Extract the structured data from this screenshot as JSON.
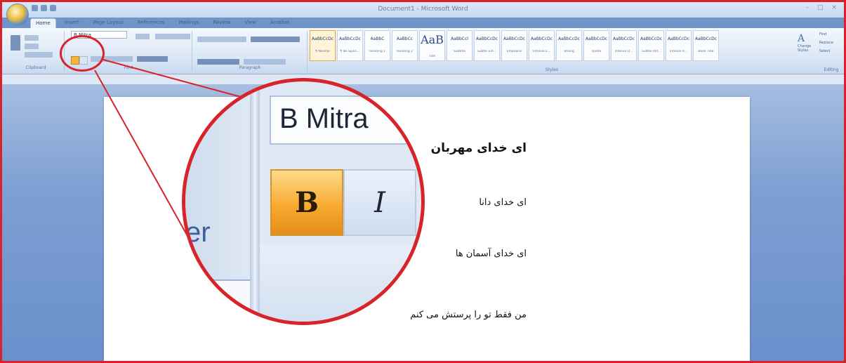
{
  "window": {
    "title": "Document1 - Microsoft Word"
  },
  "tabs": [
    "Home",
    "Insert",
    "Page Layout",
    "References",
    "Mailings",
    "Review",
    "View",
    "Acrobat"
  ],
  "ribbon": {
    "font_name": "B Mitra",
    "groups": [
      "Clipboard",
      "Font",
      "Paragraph",
      "Styles",
      "Editing"
    ],
    "styles": [
      {
        "sample": "AaBbCcDc",
        "name": "¶ Normal"
      },
      {
        "sample": "AaBbCcDc",
        "name": "¶ No Spaci..."
      },
      {
        "sample": "AaBbC",
        "name": "Heading 1"
      },
      {
        "sample": "AaBbCc",
        "name": "Heading 2"
      },
      {
        "sample": "AaB",
        "name": "Title"
      },
      {
        "sample": "AaBbCcl",
        "name": "Subtitle"
      },
      {
        "sample": "AaBbCcDc",
        "name": "Subtle Em..."
      },
      {
        "sample": "AaBbCcDc",
        "name": "Emphasis"
      },
      {
        "sample": "AaBbCcDc",
        "name": "Intense E..."
      },
      {
        "sample": "AaBbCcDc",
        "name": "Strong"
      },
      {
        "sample": "AaBbCcDc",
        "name": "Quote"
      },
      {
        "sample": "AaBbCcDc",
        "name": "Intense Q..."
      },
      {
        "sample": "AaBbCcDc",
        "name": "Subtle Ref..."
      },
      {
        "sample": "AaBbCcDc",
        "name": "Intense R..."
      },
      {
        "sample": "AaBbCcDc",
        "name": "Book Title"
      }
    ],
    "change_styles": "Change Styles",
    "editing": [
      "Find",
      "Replace",
      "Select"
    ]
  },
  "magnifier": {
    "font_name": "B Mitra",
    "bold_label": "B",
    "italic_label": "I",
    "partial_text": "er"
  },
  "document": {
    "heading": "ای خدای مهربان",
    "line1": "ای خدای دانا",
    "line2": "ای خدای آسمان ها",
    "line3": "من فقط تو را پرستش می کنم"
  }
}
